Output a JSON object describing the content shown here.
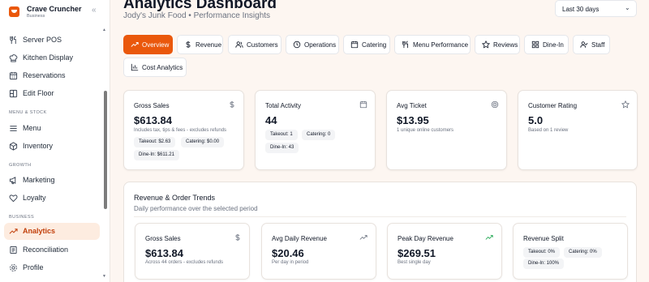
{
  "app": {
    "name": "Crave Cruncher",
    "plan": "Business",
    "collapse_glyph": "«"
  },
  "sidebar": {
    "items": [
      {
        "label": "Server POS",
        "icon": "fork-knife-icon"
      },
      {
        "label": "Kitchen Display",
        "icon": "chef-hat-icon"
      },
      {
        "label": "Reservations",
        "icon": "calendar-icon"
      },
      {
        "label": "Edit Floor",
        "icon": "floor-plan-icon"
      },
      {
        "label": "Menu",
        "icon": "menu-lines-icon"
      },
      {
        "label": "Inventory",
        "icon": "box-icon"
      },
      {
        "label": "Marketing",
        "icon": "megaphone-icon"
      },
      {
        "label": "Loyalty",
        "icon": "heart-icon"
      },
      {
        "label": "Analytics",
        "icon": "trend-up-icon",
        "active": true
      },
      {
        "label": "Reconciliation",
        "icon": "ledger-icon"
      },
      {
        "label": "Profile",
        "icon": "settings-icon"
      }
    ],
    "sections": {
      "menu_stock": "MENU & STOCK",
      "growth": "GROWTH",
      "business": "BUSINESS"
    }
  },
  "header": {
    "title": "Analytics Dashboard",
    "subtitle": "Jody's Junk Food • Performance Insights",
    "range": {
      "value": "Last 30 days",
      "chevron": "⌄"
    }
  },
  "tabs": [
    {
      "label": "Overview",
      "icon": "trend-up-icon",
      "active": true
    },
    {
      "label": "Revenue",
      "icon": "dollar-icon"
    },
    {
      "label": "Customers",
      "icon": "users-icon"
    },
    {
      "label": "Operations",
      "icon": "clock-icon"
    },
    {
      "label": "Catering",
      "icon": "calendar-icon"
    },
    {
      "label": "Menu Performance",
      "icon": "utensils-icon"
    },
    {
      "label": "Reviews",
      "icon": "star-icon"
    },
    {
      "label": "Dine-In",
      "icon": "grid-icon"
    },
    {
      "label": "Staff",
      "icon": "user-check-icon"
    },
    {
      "label": "Cost Analytics",
      "icon": "bar-chart-icon"
    }
  ],
  "kpis": {
    "gross_sales": {
      "title": "Gross Sales",
      "value": "$613.84",
      "note": "Includes tax, tips & fees - excludes refunds",
      "pills": [
        "Takeout: $2.63",
        "Catering: $0.00",
        "Dine-In: $611.21"
      ],
      "icon": "dollar-icon"
    },
    "total_activity": {
      "title": "Total Activity",
      "value": "44",
      "pills": [
        "Takeout: 1",
        "Catering: 0",
        "Dine-In: 43"
      ],
      "icon": "calendar-icon"
    },
    "avg_ticket": {
      "title": "Avg Ticket",
      "value": "$13.95",
      "note": "1 unique online customers",
      "icon": "target-icon"
    },
    "customer_rating": {
      "title": "Customer Rating",
      "value": "5.0",
      "note": "Based on 1 review",
      "icon": "star-icon"
    }
  },
  "trends": {
    "title": "Revenue & Order Trends",
    "subtitle": "Daily performance over the selected period",
    "cards": {
      "gross_sales": {
        "title": "Gross Sales",
        "value": "$613.84",
        "note": "Across 44 orders - excludes refunds",
        "icon": "dollar-icon"
      },
      "avg_daily": {
        "title": "Avg Daily Revenue",
        "value": "$20.46",
        "note": "Per day in period",
        "icon": "trend-up-icon"
      },
      "peak_day": {
        "title": "Peak Day Revenue",
        "value": "$269.51",
        "note": "Best single day",
        "icon": "trend-up-icon"
      },
      "revenue_split": {
        "title": "Revenue Split",
        "pills": [
          "Takeout: 0%",
          "Catering: 0%",
          "Dine-In: 100%"
        ]
      }
    }
  },
  "colors": {
    "accent": "#ea580c",
    "active_bg": "#fdece0",
    "page_bg": "#fdf6f1",
    "trend_green": "#16a34a"
  }
}
